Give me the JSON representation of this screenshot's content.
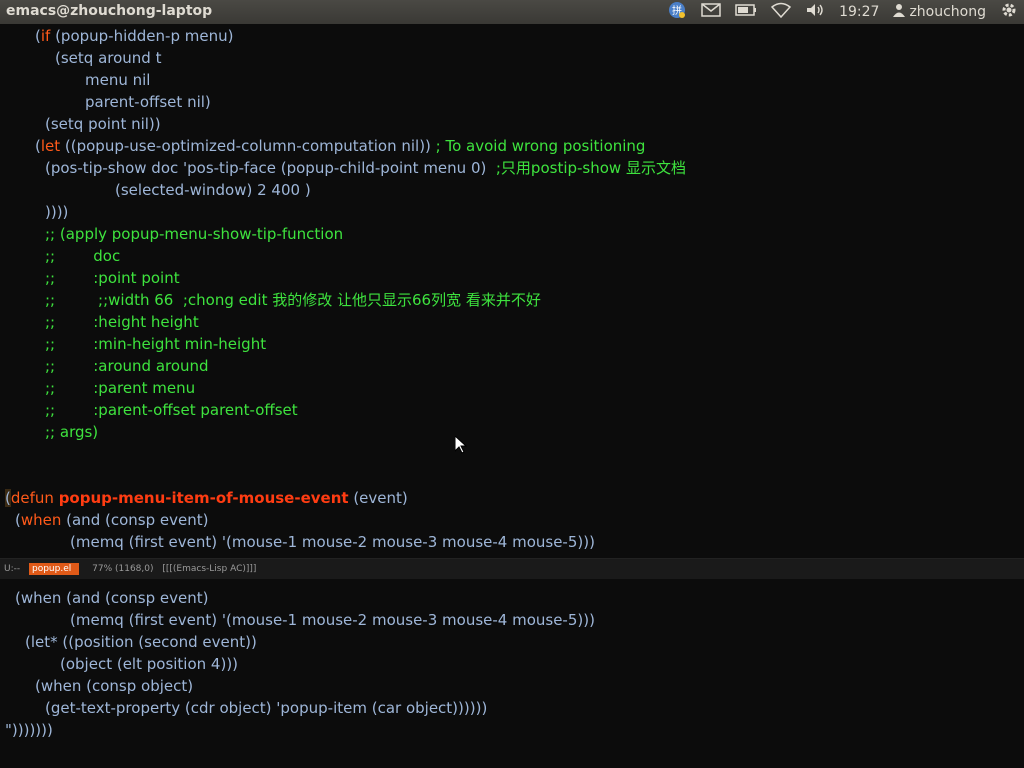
{
  "window": {
    "title": "emacs@zhouchong-laptop"
  },
  "panel": {
    "time": "19:27",
    "user": "zhouchong"
  },
  "upper_lines": [
    {
      "indent": 35,
      "parts": [
        {
          "t": "(",
          "c": "default"
        },
        {
          "t": "if",
          "c": "kw"
        },
        {
          "t": " (popup-hidden-p menu)",
          "c": "default"
        }
      ]
    },
    {
      "indent": 55,
      "parts": [
        {
          "t": "(setq around t",
          "c": "default"
        }
      ]
    },
    {
      "indent": 85,
      "parts": [
        {
          "t": "menu nil",
          "c": "default"
        }
      ]
    },
    {
      "indent": 85,
      "parts": [
        {
          "t": "parent-offset nil)",
          "c": "default"
        }
      ]
    },
    {
      "indent": 45,
      "parts": [
        {
          "t": "(setq point nil))",
          "c": "default"
        }
      ]
    },
    {
      "indent": 35,
      "parts": [
        {
          "t": "(",
          "c": "default"
        },
        {
          "t": "let",
          "c": "kw"
        },
        {
          "t": " ((popup-use-optimized-column-computation nil)) ",
          "c": "default"
        },
        {
          "t": "; To avoid wrong positioning",
          "c": "comment"
        }
      ]
    },
    {
      "indent": 45,
      "parts": [
        {
          "t": "(pos-tip-show doc 'pos-tip-face (popup-child-point menu 0)  ",
          "c": "default"
        },
        {
          "t": ";只用postip-show 显示文档",
          "c": "comment"
        }
      ]
    },
    {
      "indent": 115,
      "parts": [
        {
          "t": "(selected-window) 2 400 )",
          "c": "default"
        }
      ]
    },
    {
      "indent": 45,
      "parts": [
        {
          "t": "))))",
          "c": "default"
        }
      ]
    },
    {
      "indent": 45,
      "parts": [
        {
          "t": ";; (apply popup-menu-show-tip-function",
          "c": "comment"
        }
      ]
    },
    {
      "indent": 45,
      "parts": [
        {
          "t": ";;        doc",
          "c": "comment"
        }
      ]
    },
    {
      "indent": 45,
      "parts": [
        {
          "t": ";;        :point point",
          "c": "comment"
        }
      ]
    },
    {
      "indent": 45,
      "parts": [
        {
          "t": ";;         ;;width 66  ;chong edit 我的修改 让他只显示66列宽 看来并不好",
          "c": "comment"
        }
      ]
    },
    {
      "indent": 45,
      "parts": [
        {
          "t": ";;        :height height",
          "c": "comment"
        }
      ]
    },
    {
      "indent": 45,
      "parts": [
        {
          "t": ";;        :min-height min-height",
          "c": "comment"
        }
      ]
    },
    {
      "indent": 45,
      "parts": [
        {
          "t": ";;        :around around",
          "c": "comment"
        }
      ]
    },
    {
      "indent": 45,
      "parts": [
        {
          "t": ";;        :parent menu",
          "c": "comment"
        }
      ]
    },
    {
      "indent": 45,
      "parts": [
        {
          "t": ";;        :parent-offset parent-offset",
          "c": "comment"
        }
      ]
    },
    {
      "indent": 45,
      "parts": [
        {
          "t": ";; args)",
          "c": "comment"
        }
      ]
    },
    {
      "indent": 0,
      "parts": []
    },
    {
      "indent": 0,
      "parts": []
    },
    {
      "indent": 5,
      "parts": [
        {
          "t": "(",
          "c": "paren"
        },
        {
          "t": "defun",
          "c": "kw"
        },
        {
          "t": " ",
          "c": "default"
        },
        {
          "t": "popup-menu-item-of-mouse-event",
          "c": "fn"
        },
        {
          "t": " (event)",
          "c": "default"
        }
      ]
    },
    {
      "indent": 15,
      "parts": [
        {
          "t": "(",
          "c": "default"
        },
        {
          "t": "when",
          "c": "kw"
        },
        {
          "t": " (and (consp event)",
          "c": "default"
        }
      ]
    },
    {
      "indent": 70,
      "parts": [
        {
          "t": "(memq (first event) '(mouse-1 mouse-2 mouse-3 mouse-4 mouse-5)))",
          "c": "default"
        }
      ]
    }
  ],
  "modeline": {
    "state": "U:--",
    "buffer": "popup.el",
    "position": "77% (1168,0)",
    "mode": "[[[(Emacs-Lisp AC)]]]"
  },
  "lower_lines": [
    {
      "indent": 15,
      "parts": [
        {
          "t": "(when (and (consp event)",
          "c": "default"
        }
      ]
    },
    {
      "indent": 70,
      "parts": [
        {
          "t": "(memq (first event) '(mouse-1 mouse-2 mouse-3 mouse-4 mouse-5)))",
          "c": "default"
        }
      ]
    },
    {
      "indent": 25,
      "parts": [
        {
          "t": "(let* ((position (second event))",
          "c": "default"
        }
      ]
    },
    {
      "indent": 60,
      "parts": [
        {
          "t": "(object (elt position 4)))",
          "c": "default"
        }
      ]
    },
    {
      "indent": 35,
      "parts": [
        {
          "t": "(when (consp object)",
          "c": "default"
        }
      ]
    },
    {
      "indent": 45,
      "parts": [
        {
          "t": "(get-text-property (cdr object) 'popup-item (car object))))))",
          "c": "default"
        }
      ]
    },
    {
      "indent": 5,
      "parts": [
        {
          "t": "\")))))))",
          "c": "default"
        }
      ]
    }
  ],
  "icons": {
    "input_method": "keyboard-input-icon",
    "mail": "mail-icon",
    "battery": "battery-icon",
    "network": "wifi-icon",
    "volume": "volume-icon",
    "user": "user-icon",
    "session": "gear-icon"
  }
}
